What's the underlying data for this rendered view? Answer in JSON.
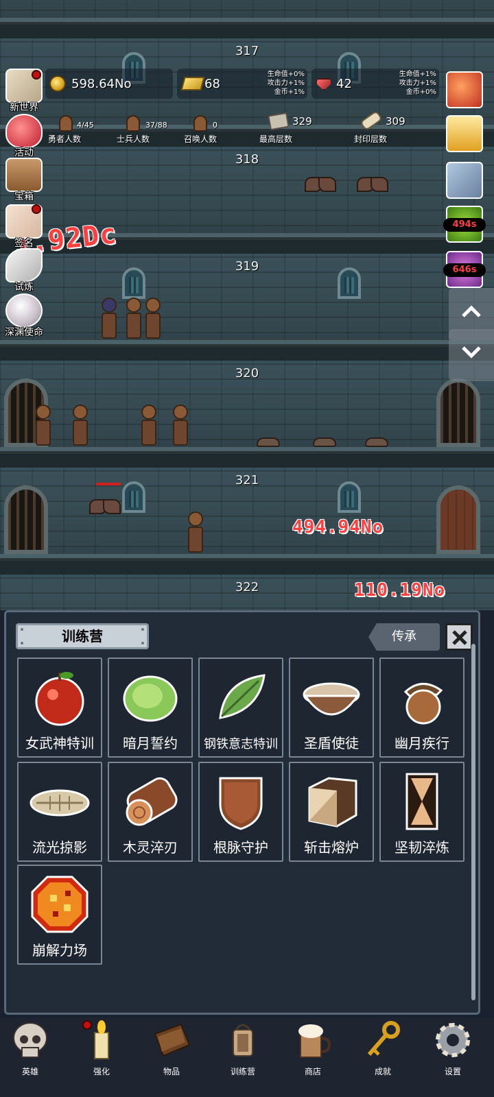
{
  "floors": [
    "317",
    "318",
    "319",
    "320",
    "321",
    "322"
  ],
  "stats": {
    "coins": "598.64No",
    "gold_bars": "68",
    "gold_bonus": [
      "生命值+0%",
      "攻击力+1%",
      "金币+1%"
    ],
    "gems": "42",
    "gem_bonus": [
      "生命值+1%",
      "攻击力+1%",
      "金币+0%"
    ],
    "heroes": {
      "value": "4/45",
      "label": "勇者人数"
    },
    "soldiers": {
      "value": "37/88",
      "label": "士兵人数"
    },
    "summons": {
      "value": "0",
      "label": "召唤人数"
    },
    "max_floor": {
      "value": "329",
      "label": "最高层数"
    },
    "sealed_floor": {
      "value": "309",
      "label": "封印层数"
    }
  },
  "left_menu": [
    {
      "label": "新世界",
      "icon": "map-icon",
      "dot": true
    },
    {
      "label": "活动",
      "icon": "heart-icon",
      "dot": false
    },
    {
      "label": "宝箱",
      "icon": "chest-icon",
      "dot": false
    },
    {
      "label": "签名",
      "icon": "letter-icon",
      "dot": true
    },
    {
      "label": "试炼",
      "icon": "feather-icon",
      "dot": false
    },
    {
      "label": "深渊使命",
      "icon": "pearl-icon",
      "dot": false
    }
  ],
  "right_buffs": [
    {
      "icon": "apple-buff-icon",
      "timer": ""
    },
    {
      "icon": "candle-buff-icon",
      "timer": ""
    },
    {
      "icon": "meat-buff-icon",
      "timer": ""
    },
    {
      "icon": "green-buff-icon",
      "timer": "494s"
    },
    {
      "icon": "purple-buff-icon",
      "timer": "646s"
    }
  ],
  "damage_numbers": [
    "1.92Dc",
    "494.94No",
    "110.19No"
  ],
  "panel": {
    "title": "训练营",
    "inherit_label": "传承",
    "items": [
      {
        "name": "女武神特训",
        "icon": "apple-icon"
      },
      {
        "name": "暗月誓约",
        "icon": "cabbage-icon"
      },
      {
        "name": "钢铁意志特训",
        "icon": "leaf-icon"
      },
      {
        "name": "圣盾使徒",
        "icon": "bowl-icon"
      },
      {
        "name": "幽月疾行",
        "icon": "acorn-icon"
      },
      {
        "name": "流光掠影",
        "icon": "fish-bone-icon"
      },
      {
        "name": "木灵淬刃",
        "icon": "log-icon"
      },
      {
        "name": "根脉守护",
        "icon": "wood-shield-icon"
      },
      {
        "name": "斩击熔炉",
        "icon": "wood-block-icon"
      },
      {
        "name": "坚韧淬炼",
        "icon": "plank-icon"
      },
      {
        "name": "崩解力场",
        "icon": "lava-orb-icon"
      }
    ]
  },
  "bottom_nav": [
    {
      "label": "英雄",
      "icon": "skull-icon",
      "dot": false
    },
    {
      "label": "强化",
      "icon": "candle-icon",
      "dot": true
    },
    {
      "label": "物品",
      "icon": "book-icon",
      "dot": false
    },
    {
      "label": "训练营",
      "icon": "lantern-icon",
      "dot": false
    },
    {
      "label": "商店",
      "icon": "beer-icon",
      "dot": false
    },
    {
      "label": "成就",
      "icon": "key-icon",
      "dot": false
    },
    {
      "label": "设置",
      "icon": "gear-icon",
      "dot": false
    }
  ],
  "colors": {
    "panel_bg": "#222b38",
    "damage_red": "#ff4040",
    "timer_red": "#ff4040"
  }
}
